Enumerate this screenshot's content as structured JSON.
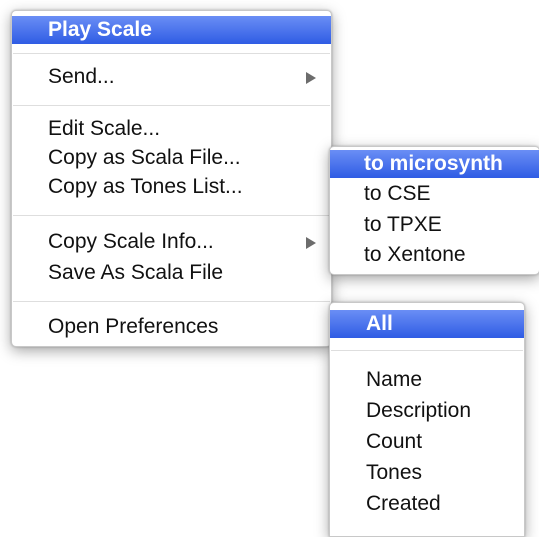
{
  "main_menu": {
    "play_scale": "Play Scale",
    "send": "Send...",
    "edit_scale": "Edit Scale...",
    "copy_as_scala_file": "Copy as Scala File...",
    "copy_as_tones_list": "Copy as Tones List...",
    "copy_scale_info": "Copy Scale Info...",
    "save_as_scala_file": "Save As Scala File",
    "open_preferences": "Open Preferences"
  },
  "send_submenu": {
    "items": [
      "to microsynth",
      "to CSE",
      "to TPXE",
      "to Xentone"
    ]
  },
  "copy_scale_info_submenu": {
    "all": "All",
    "items": [
      "Name",
      "Description",
      "Count",
      "Tones",
      "Created"
    ]
  },
  "icons": {
    "submenu_arrow": "triangle-right-icon"
  },
  "colors": {
    "selection": "#3f69e8",
    "selection_text": "#ffffff",
    "text": "#111111",
    "separator": "#dedede",
    "arrow": "#6c6c6c"
  }
}
